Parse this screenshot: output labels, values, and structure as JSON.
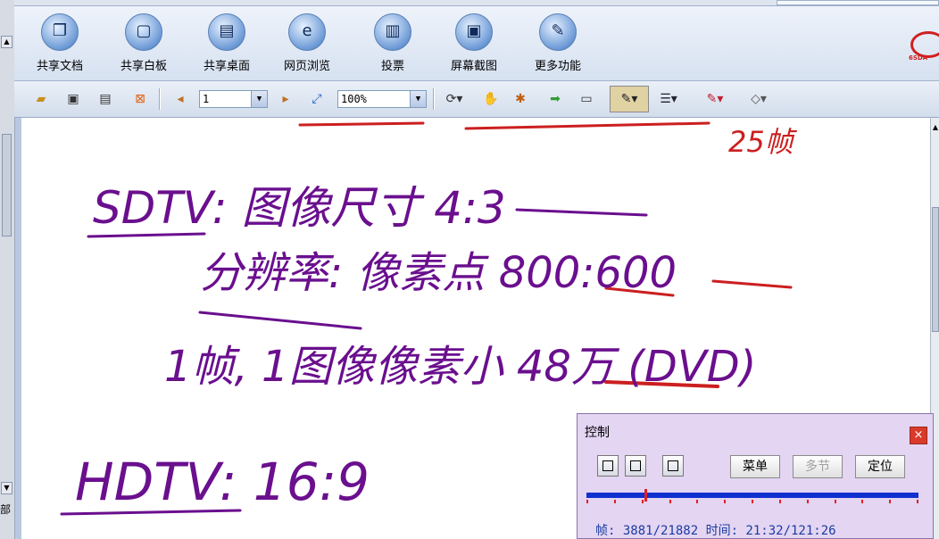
{
  "main_toolbar": {
    "buttons": [
      {
        "label": "共享文档",
        "icon": "document-icon",
        "glyph": "❐"
      },
      {
        "label": "共享白板",
        "icon": "whiteboard-icon",
        "glyph": "▢"
      },
      {
        "label": "共享桌面",
        "icon": "desktop-share-icon",
        "glyph": "▤"
      },
      {
        "label": "网页浏览",
        "icon": "browser-icon",
        "glyph": "e"
      },
      {
        "label": "投票",
        "icon": "vote-chart-icon",
        "glyph": "▥"
      },
      {
        "label": "屏幕截图",
        "icon": "screenshot-icon",
        "glyph": "▣"
      },
      {
        "label": "更多功能",
        "icon": "tools-icon",
        "glyph": "✎"
      }
    ]
  },
  "doc_toolbar": {
    "page_number": "1",
    "zoom": "100%",
    "icons": [
      "open-folder-icon",
      "save-icon",
      "print-icon",
      "close-doc-icon",
      "prev-page-icon",
      "next-page-icon",
      "fit-page-icon",
      "rotate-icon",
      "hand-icon",
      "laser-pointer-icon",
      "arrow-icon",
      "text-tool-icon",
      "pen-icon",
      "line-width-icon",
      "color-icon",
      "eraser-icon"
    ]
  },
  "whiteboard": {
    "lines": [
      {
        "text": "25帧",
        "color": "#cc1f1f"
      },
      {
        "text": "SDTV: 图像尺寸 4:3",
        "color": "#6a0f8e"
      },
      {
        "text": "分辨率: 像素点 800:600",
        "color": "#6a0f8e"
      },
      {
        "text": "1帧, 1图像像素小 48万 (DVD)",
        "color": "#6a0f8e"
      },
      {
        "text": "HDTV: 16:9",
        "color": "#6a0f8e"
      }
    ]
  },
  "control_panel": {
    "title": "控制",
    "close_label": "×",
    "menu_label": "菜单",
    "section_label": "多节",
    "locate_label": "定位",
    "status": "帧: 3881/21882 时间: 21:32/121:26",
    "progress": 0.177
  },
  "left_panel": {
    "cut_text": "部"
  },
  "colors": {
    "ink_purple": "#6a0f8e",
    "ink_red": "#cc1f1f",
    "panel_bg": "#e4d5f3",
    "progress_blue": "#1030d0"
  }
}
